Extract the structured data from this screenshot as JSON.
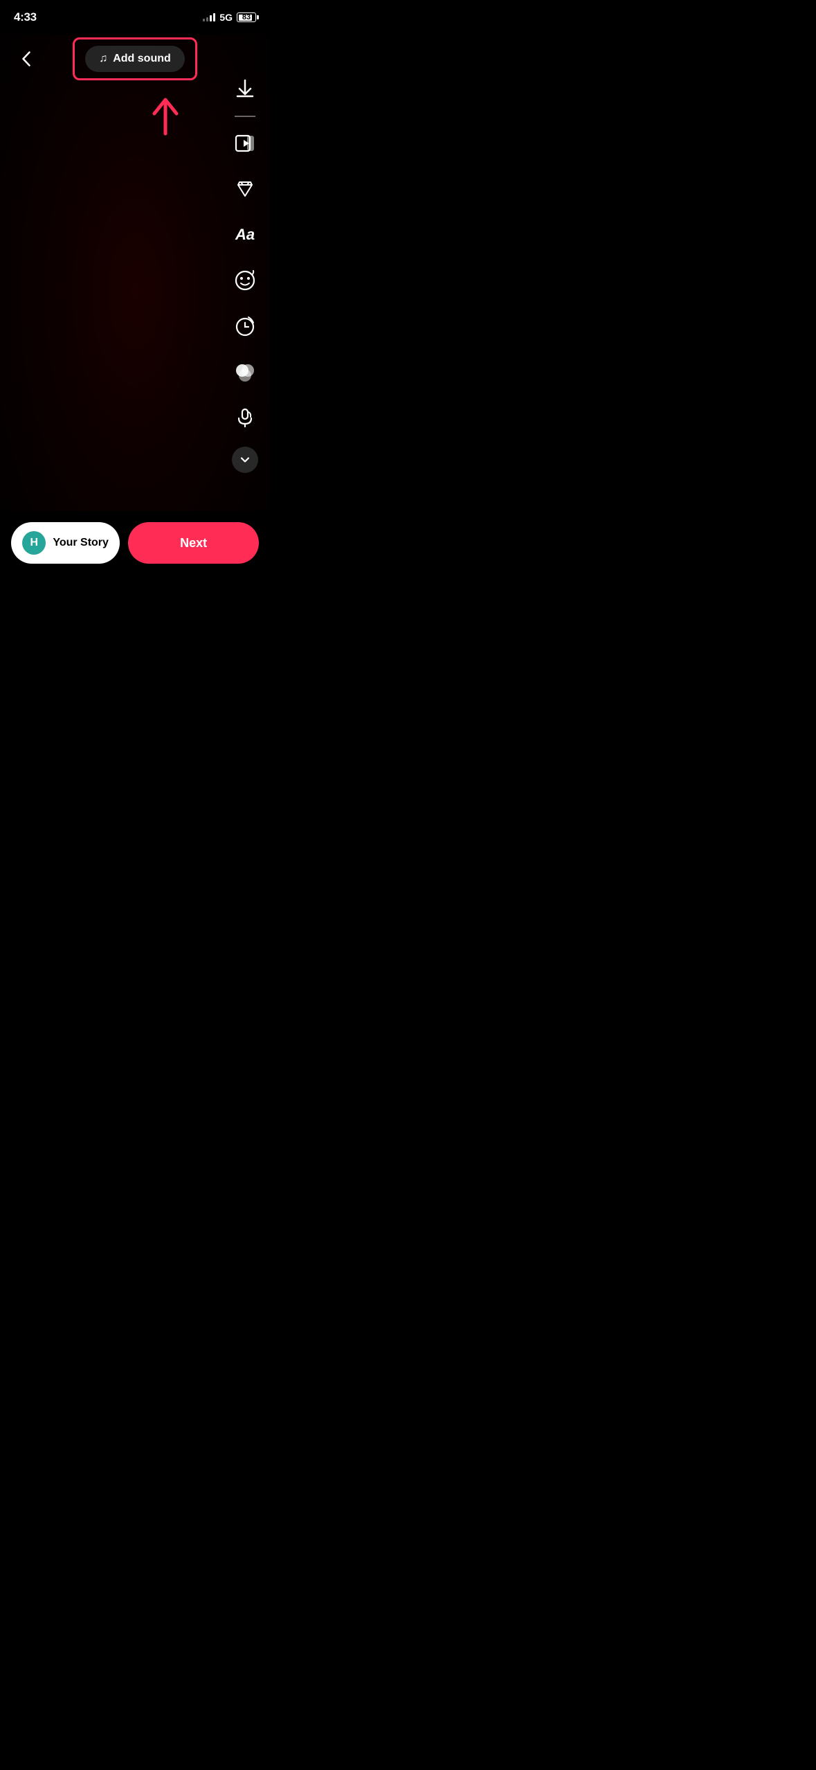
{
  "statusBar": {
    "time": "4:33",
    "signal": "5G",
    "battery": 83
  },
  "topControls": {
    "backLabel": "‹",
    "addSoundLabel": "Add sound"
  },
  "rightTools": [
    {
      "name": "download-icon",
      "label": "Download"
    },
    {
      "name": "template-icon",
      "label": "Template"
    },
    {
      "name": "effects-icon",
      "label": "Effects"
    },
    {
      "name": "text-icon",
      "label": "Text"
    },
    {
      "name": "sticker-icon",
      "label": "Sticker"
    },
    {
      "name": "timer-icon",
      "label": "Timer"
    },
    {
      "name": "color-icon",
      "label": "Color"
    },
    {
      "name": "voiceover-icon",
      "label": "Voiceover"
    },
    {
      "name": "more-icon",
      "label": "More"
    }
  ],
  "bottomBar": {
    "storyAvatarLetter": "H",
    "storyLabel": "Your Story",
    "nextLabel": "Next"
  }
}
